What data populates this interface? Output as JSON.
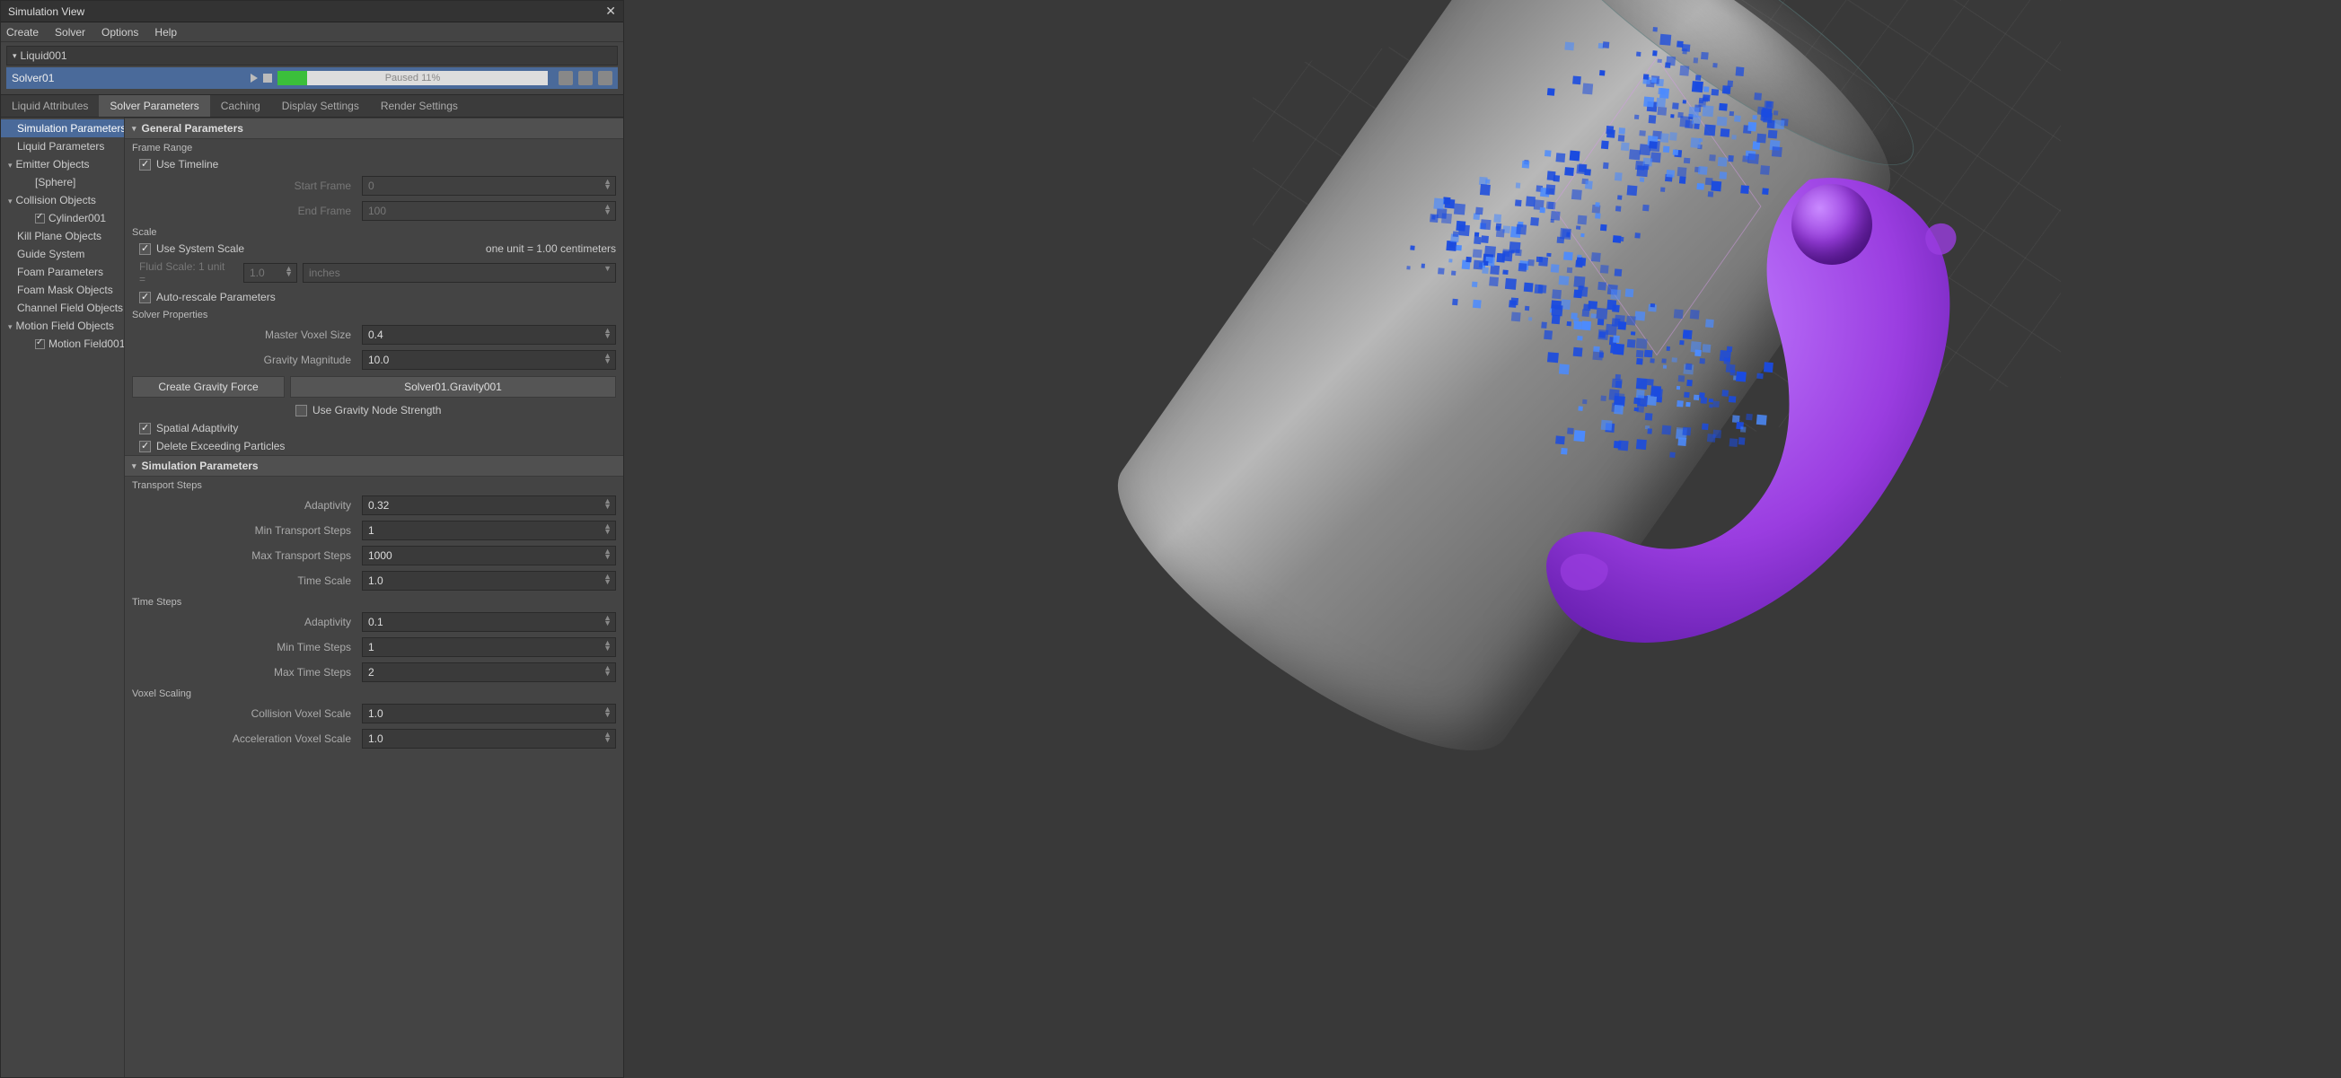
{
  "window": {
    "title": "Simulation View"
  },
  "menu": [
    "Create",
    "Solver",
    "Options",
    "Help"
  ],
  "object": {
    "name": "Liquid001"
  },
  "solver": {
    "name": "Solver01",
    "progress_label": "Paused 11%"
  },
  "tabs": [
    "Liquid Attributes",
    "Solver Parameters",
    "Caching",
    "Display Settings",
    "Render Settings"
  ],
  "active_tab": 1,
  "sidebar": [
    {
      "label": "Simulation Parameters",
      "selected": true
    },
    {
      "label": "Liquid Parameters"
    },
    {
      "label": "Emitter Objects",
      "parent": true
    },
    {
      "label": "[Sphere]",
      "child": true
    },
    {
      "label": "Collision Objects",
      "parent": true
    },
    {
      "label": "Cylinder001",
      "child": true,
      "checked": true
    },
    {
      "label": "Kill Plane Objects"
    },
    {
      "label": "Guide System"
    },
    {
      "label": "Foam Parameters"
    },
    {
      "label": "Foam Mask Objects"
    },
    {
      "label": "Channel Field Objects"
    },
    {
      "label": "Motion Field Objects",
      "parent": true
    },
    {
      "label": "Motion Field001",
      "child": true,
      "checked": true
    }
  ],
  "general": {
    "header": "General Parameters",
    "frame_range_label": "Frame Range",
    "use_timeline_label": "Use Timeline",
    "start_frame_label": "Start Frame",
    "start_frame": "0",
    "end_frame_label": "End Frame",
    "end_frame": "100",
    "scale_label": "Scale",
    "use_system_scale_label": "Use System Scale",
    "unit_hint": "one unit = 1.00 centimeters",
    "fluid_scale_label": "Fluid Scale: 1 unit =",
    "fluid_scale_value": "1.0",
    "fluid_scale_unit": "inches",
    "auto_rescale_label": "Auto-rescale Parameters",
    "solver_props_label": "Solver Properties",
    "master_voxel_label": "Master Voxel Size",
    "master_voxel": "0.4",
    "gravity_mag_label": "Gravity Magnitude",
    "gravity_mag": "10.0",
    "create_gravity_btn": "Create Gravity Force",
    "gravity_node": "Solver01.Gravity001",
    "use_gravity_node_label": "Use Gravity Node Strength",
    "spatial_adaptivity_label": "Spatial Adaptivity",
    "delete_exceeding_label": "Delete Exceeding Particles"
  },
  "simparams": {
    "header": "Simulation Parameters",
    "transport_label": "Transport Steps",
    "t_adaptivity_label": "Adaptivity",
    "t_adaptivity": "0.32",
    "t_min_label": "Min Transport Steps",
    "t_min": "1",
    "t_max_label": "Max Transport Steps",
    "t_max": "1000",
    "time_scale_label": "Time Scale",
    "time_scale": "1.0",
    "time_steps_label": "Time Steps",
    "ts_adaptivity_label": "Adaptivity",
    "ts_adaptivity": "0.1",
    "ts_min_label": "Min Time Steps",
    "ts_min": "1",
    "ts_max_label": "Max Time Steps",
    "ts_max": "2",
    "voxel_scaling_label": "Voxel Scaling",
    "coll_voxel_label": "Collision Voxel Scale",
    "coll_voxel": "1.0",
    "accel_voxel_label": "Acceleration Voxel Scale",
    "accel_voxel": "1.0"
  }
}
